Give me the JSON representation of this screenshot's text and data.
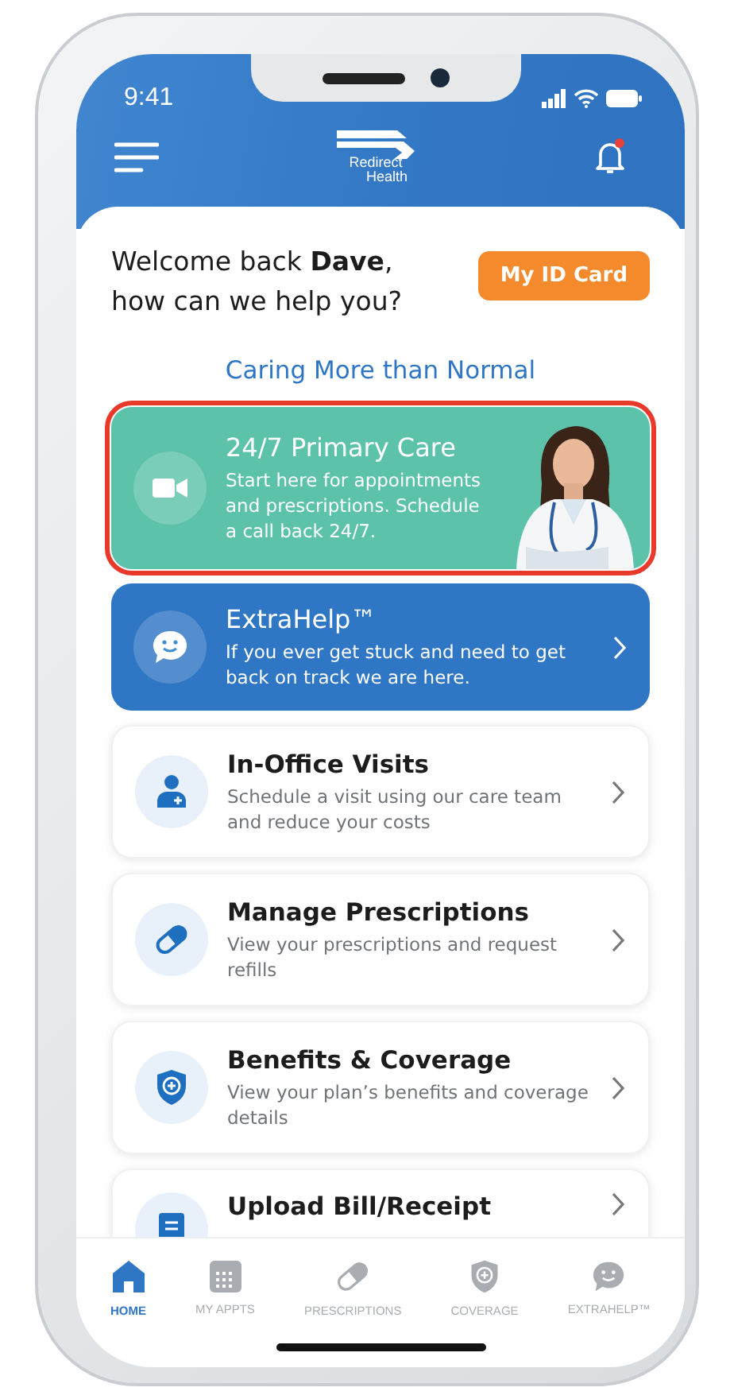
{
  "status_bar": {
    "time": "9:41"
  },
  "header": {
    "logo_top": "Redirect",
    "logo_bottom": "Health",
    "notification": true
  },
  "welcome": {
    "greeting": "Welcome back **Dave**,",
    "question": "how can we help you?",
    "id_button": "My ID Card"
  },
  "tagline": "Caring More than Normal",
  "cards": [
    {
      "kind": "featured",
      "title": "24/7 Primary Care",
      "description": "Start here for appointments and prescriptions. Schedule a call back 24/7."
    },
    {
      "kind": "highlight",
      "title": "ExtraHelp™",
      "description": "If you ever get stuck and need to get back on track we are here."
    },
    {
      "kind": "plain",
      "title": "In-Office Visits",
      "description": "Schedule a visit using our care team and reduce your costs"
    },
    {
      "kind": "plain",
      "title": "Manage Prescriptions",
      "description": "View your prescriptions and request refills"
    },
    {
      "kind": "plain",
      "title": "Benefits & Coverage",
      "description": "View your plan’s benefits and coverage details"
    },
    {
      "kind": "plain",
      "title": "Upload Bill/Receipt"
    }
  ],
  "nav": [
    {
      "label": "HOME",
      "selected": true
    },
    {
      "label": "MY APPTS",
      "selected": false
    },
    {
      "label": "PRESCRIPTIONS",
      "selected": false
    },
    {
      "label": "COVERAGE",
      "selected": false
    },
    {
      "label": "EXTRAHELP™",
      "selected": false
    }
  ]
}
